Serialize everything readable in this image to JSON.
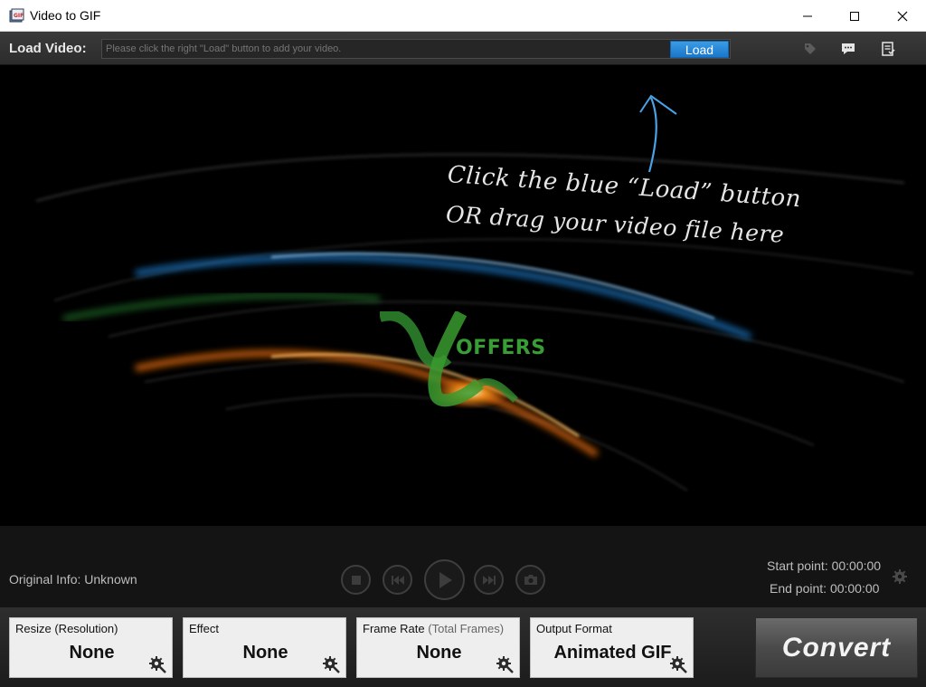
{
  "window": {
    "title": "Video to GIF"
  },
  "toolbar": {
    "load_label": "Load Video:",
    "path_placeholder": "Please click the right \"Load\" button to add your video.",
    "load_button": "Load",
    "icons": [
      "tag-icon",
      "feedback-icon",
      "register-icon"
    ]
  },
  "preview": {
    "hint_line1": "Click the blue “Load” button",
    "hint_line2": "OR drag your video file here",
    "watermark": "OFFERS"
  },
  "playback": {
    "original_info": "Original Info: Unknown",
    "start_point": "Start point: 00:00:00",
    "end_point": "End point: 00:00:00",
    "buttons": [
      "stop",
      "previous",
      "play",
      "next",
      "snapshot"
    ]
  },
  "settings": {
    "resize": {
      "label": "Resize (Resolution)",
      "value": "None"
    },
    "effect": {
      "label": "Effect",
      "value": "None"
    },
    "frame_rate": {
      "label": "Frame Rate",
      "sub": "(Total Frames)",
      "value": "None"
    },
    "output_format": {
      "label": "Output Format",
      "value": "Animated GIF"
    }
  },
  "convert_button": "Convert",
  "colors": {
    "accent_blue": "#1a77c9",
    "background": "#000000"
  }
}
